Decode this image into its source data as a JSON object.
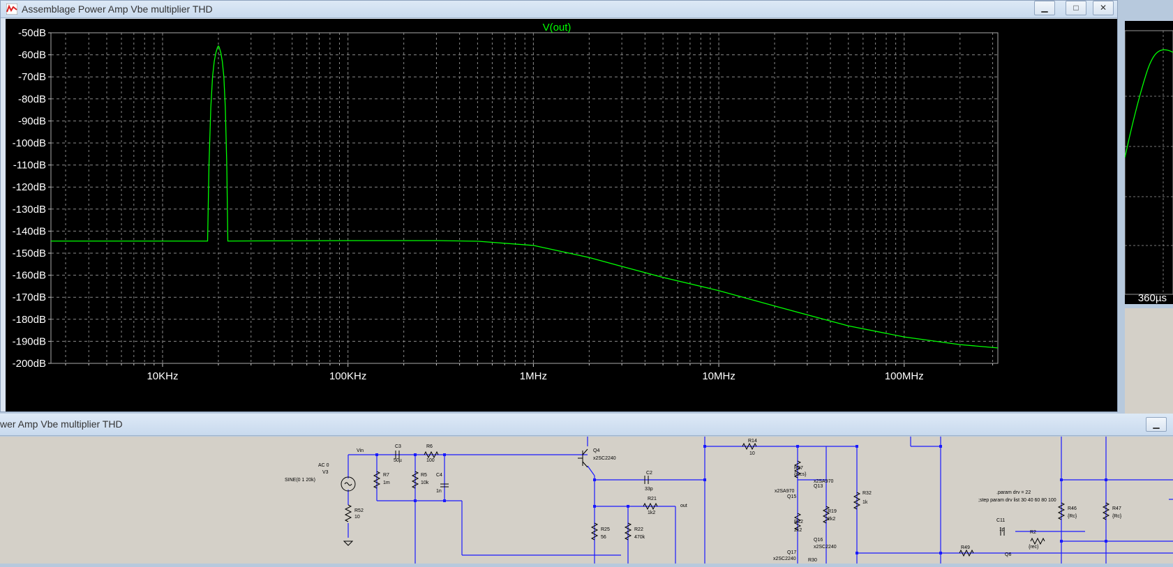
{
  "plot_window": {
    "title": "Assemblage Power Amp Vbe multiplier THD",
    "buttons": {
      "minimize": "▁",
      "maximize": "□",
      "close": "✕"
    }
  },
  "schematic_window": {
    "title": "wer Amp Vbe multiplier THD",
    "button": "▁"
  },
  "side_window": {
    "time_label": "360µs"
  },
  "colors": {
    "trace": "#00ff00",
    "grid": "#8a8a8a",
    "plot_bg": "#000000",
    "wire": "#0000ff"
  },
  "chart_data": {
    "type": "line",
    "title": "V(out)",
    "x_scale": "log",
    "xlim": [
      2500,
      320000000
    ],
    "ylim": [
      -200,
      -50
    ],
    "y_ticks": [
      -50,
      -60,
      -70,
      -80,
      -90,
      -100,
      -110,
      -120,
      -130,
      -140,
      -150,
      -160,
      -170,
      -180,
      -190,
      -200
    ],
    "y_tick_labels": [
      "-50dB",
      "-60dB",
      "-70dB",
      "-80dB",
      "-90dB",
      "-100dB",
      "-110dB",
      "-120dB",
      "-130dB",
      "-140dB",
      "-150dB",
      "-160dB",
      "-170dB",
      "-180dB",
      "-190dB",
      "-200dB"
    ],
    "x_ticks": [
      10000,
      100000,
      1000000,
      10000000,
      100000000
    ],
    "x_tick_labels": [
      "10KHz",
      "100KHz",
      "1MHz",
      "10MHz",
      "100MHz"
    ],
    "grid": true,
    "series": [
      {
        "name": "V(out)",
        "x": [
          2500,
          17500,
          17800,
          18200,
          18600,
          19000,
          19400,
          19800,
          20000,
          20200,
          20600,
          21000,
          21400,
          21800,
          22200,
          22500,
          100000,
          300000,
          500000,
          1000000,
          2000000,
          3000000,
          5000000,
          10000000,
          20000000,
          50000000,
          100000000,
          200000000,
          320000000
        ],
        "y": [
          -144.5,
          -144.5,
          -110,
          -84,
          -70,
          -63,
          -59,
          -56.5,
          -56,
          -56.5,
          -59,
          -63,
          -70,
          -84,
          -110,
          -144.5,
          -144.3,
          -144.3,
          -144.6,
          -146.5,
          -152,
          -156,
          -161,
          -167,
          -174,
          -183,
          -188,
          -191.5,
          -193
        ]
      }
    ]
  },
  "schematic": {
    "labels": [
      "Vin",
      "AC 0",
      "V3",
      "SINE(0 1 20k)",
      "R52",
      "10",
      "R7",
      "1m",
      "C3",
      "50µ",
      "R6",
      "100",
      "R5",
      "10k",
      "C4",
      "1n",
      "Q4",
      "x2SC2240",
      "C2",
      "33p",
      "R21",
      "1k2",
      "out",
      "R25",
      "56",
      "R22",
      "470k",
      "R14",
      "10",
      "R27",
      "{rccs}",
      "Q13",
      "x2SA970",
      "Q15",
      "x2SA970",
      "R12",
      "2k2",
      "R19",
      "2k2",
      "Q16",
      "x2SC2240",
      "Q17",
      "x2SC2240",
      "R30",
      "R32",
      "1k",
      ".param drv = 22",
      ";step param drv list 30 40 60 80 100",
      "C11",
      "1p",
      "R2",
      "{rec}",
      "R49",
      "Q6",
      "R46",
      "{Rc}",
      "R47",
      "{Rc}"
    ]
  }
}
